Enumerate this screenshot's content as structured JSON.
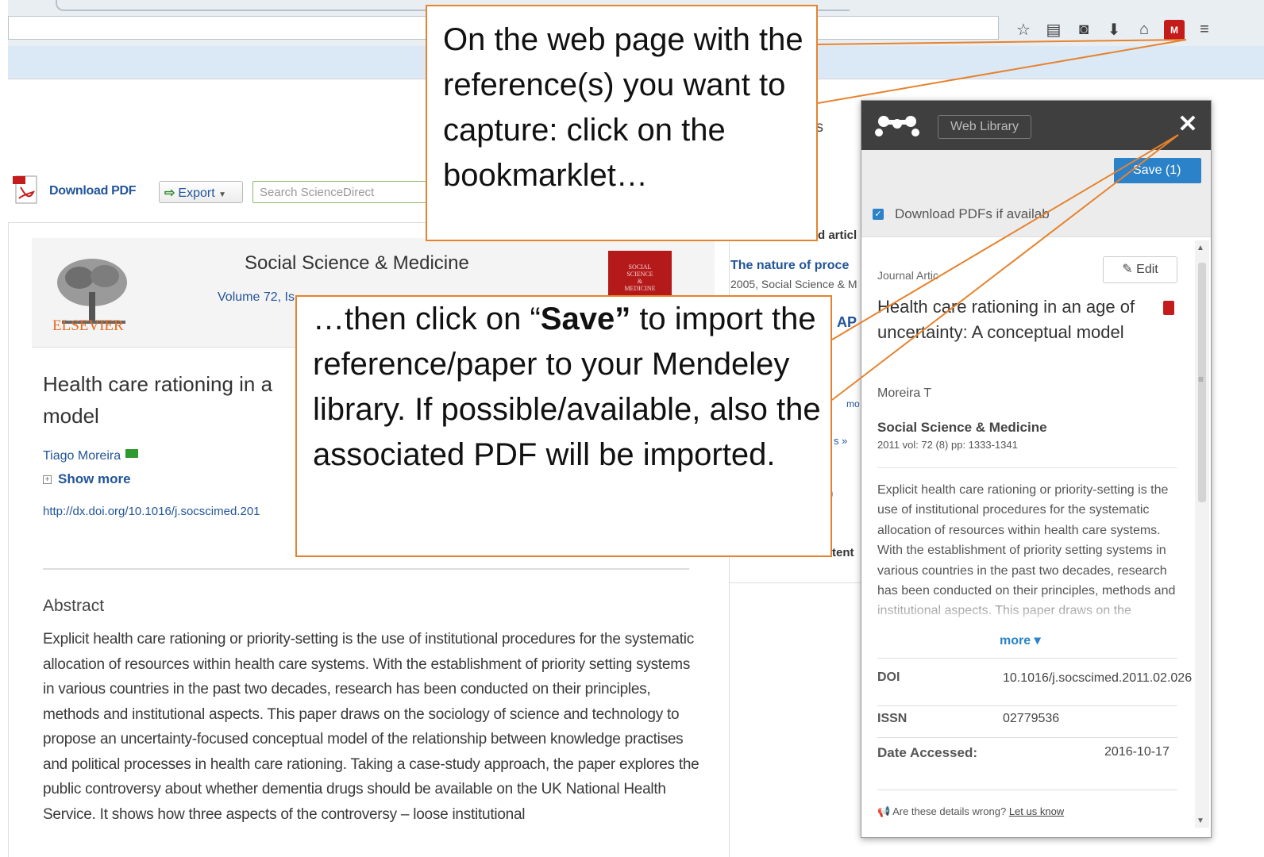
{
  "browser": {
    "toolbar_icons": [
      "star-icon",
      "reading-list-icon",
      "pocket-icon",
      "download-icon",
      "home-icon",
      "mendeley-icon",
      "menu-icon"
    ],
    "toolbar_glyphs": [
      "☆",
      "▤",
      "◙",
      "⬇",
      "⌂",
      "M",
      "≡"
    ]
  },
  "sd_toolbar": {
    "download_pdf": "Download PDF",
    "export": "Export",
    "search_placeholder": "Search ScienceDirect"
  },
  "article": {
    "publisher": "ELSEVIER",
    "journal": "Social Science & Medicine",
    "volume": "Volume 72, Is",
    "title": "Health care rationing in a model",
    "author": "Tiago Moreira",
    "show_more": "Show more",
    "doi": "http://dx.doi.org/10.1016/j.socscimed.201",
    "abstract_heading": "Abstract",
    "abstract": "Explicit health care rationing or priority-setting is the use of institutional procedures for the systematic allocation of resources within health care systems. With the establishment of priority setting systems in various countries in the past two decades, research has been conducted on their principles, methods and institutional aspects. This paper draws on the sociology of science and technology to propose an uncertainty-focused conceptual model of the relationship between knowledge practises and political processes in health care rationing. Taking a case-study approach, the paper explores the public controversy about whether dementia drugs should be available on the UK National Health Service. It shows how three aspects of the controversy – loose institutional"
  },
  "right_column": {
    "k": "ks",
    "related": "d articl",
    "item_title": "The nature of proce",
    "item_meta": "2005, Social Science & M",
    "ap": "AP",
    "mo": "mo",
    "s": "s »",
    "paren": ")",
    "tent": "tent"
  },
  "mendeley": {
    "web_library": "Web Library",
    "close": "✕",
    "save": "Save (1)",
    "download_pdfs": "Download PDFs if availab",
    "type": "Journal Artic",
    "edit": "Edit",
    "title": "Health care rationing in an age of uncertainty: A conceptual model",
    "authors": "Moreira T",
    "journal": "Social Science & Medicine",
    "citation": "2011 vol: 72 (8) pp: 1333-1341",
    "abstract": "Explicit health care rationing or priority-setting is the use of institutional procedures for the systematic allocation of resources within health care systems. With the establishment of priority setting systems in various countries in the past two decades, research has been conducted on their principles, methods and institutional aspects. This paper draws on the sociology of",
    "more": "more ▾",
    "doi_label": "DOI",
    "doi_value": "10.1016/j.socscimed.2011.02.026",
    "issn_label": "ISSN",
    "issn_value": "02779536",
    "date_label": "Date Accessed:",
    "date_value": "2016-10-17",
    "wrong_text": "Are these details wrong?",
    "wrong_link": "Let us know"
  },
  "callouts": {
    "first": "On the web page with the reference(s) you want to capture: click on the bookmarklet…",
    "second_pre": "…then click on “",
    "second_bold": "Save”",
    "second_post": " to import the reference/paper to your Mendeley library. If possible/available, also the associated PDF will be imported."
  },
  "colors": {
    "callout_border": "#e6832e",
    "mendeley_blue": "#2b82c9",
    "link_blue": "#225599"
  }
}
